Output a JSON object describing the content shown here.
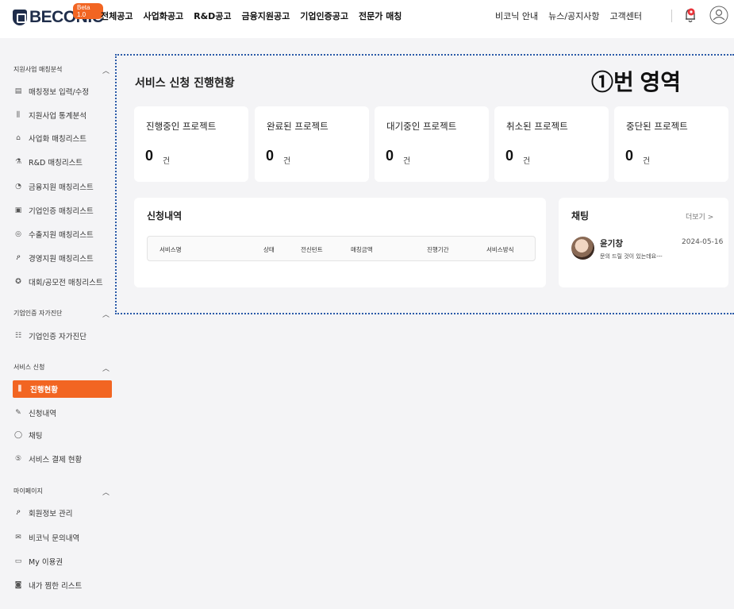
{
  "brand": {
    "logo_text": "BECONIC",
    "beta_badge": "Beta 1.0",
    "accent": "#f26522",
    "navy": "#1f2d4a"
  },
  "gnb": [
    "전체공고",
    "사업화공고",
    "R&D공고",
    "금융지원공고",
    "기업인증공고",
    "전문가 매칭"
  ],
  "util_nav": [
    "비코닉 안내",
    "뉴스/공지사항",
    "고객센터"
  ],
  "sidebar": {
    "sections": [
      {
        "title": "지원사업 매칭분석",
        "items": [
          {
            "icon": "document-icon",
            "label": "매칭정보 입력/수정"
          },
          {
            "icon": "chart-icon",
            "label": "지원사업 통계분석"
          },
          {
            "icon": "building-icon",
            "label": "사업화 매칭리스트"
          },
          {
            "icon": "flask-icon",
            "label": "R&D 매칭리스트"
          },
          {
            "icon": "coin-icon",
            "label": "금융지원 매칭리스트"
          },
          {
            "icon": "certificate-icon",
            "label": "기업인증 매칭리스트"
          },
          {
            "icon": "globe-icon",
            "label": "수출지원 매칭리스트"
          },
          {
            "icon": "people-icon",
            "label": "경영지원 매칭리스트"
          },
          {
            "icon": "medal-icon",
            "label": "대회/공모전 매칭리스트"
          }
        ]
      },
      {
        "title": "기업인증 자가진단",
        "items": [
          {
            "icon": "checklist-icon",
            "label": "기업인증 자가진단"
          }
        ]
      },
      {
        "title": "서비스 신청",
        "items": [
          {
            "icon": "chart-icon",
            "label": "진행현황",
            "active": true
          },
          {
            "icon": "edit-icon",
            "label": "신청내역"
          },
          {
            "icon": "chat-icon",
            "label": "채팅"
          },
          {
            "icon": "payment-icon",
            "label": "서비스 결제 현황"
          }
        ]
      },
      {
        "title": "마이페이지",
        "items": [
          {
            "icon": "user-edit-icon",
            "label": "회원정보 관리"
          },
          {
            "icon": "mail-icon",
            "label": "비코닉 문의내역"
          },
          {
            "icon": "ticket-icon",
            "label": "My 이용권"
          },
          {
            "icon": "bookmark-icon",
            "label": "내가 찜한 리스트"
          }
        ]
      }
    ]
  },
  "main": {
    "title": "서비스 신청 진행현황",
    "region_label": "①번 영역",
    "stats": [
      {
        "label": "진행중인 프로젝트",
        "value": "0",
        "unit": "건"
      },
      {
        "label": "완료된 프로젝트",
        "value": "0",
        "unit": "건"
      },
      {
        "label": "대기중인 프로젝트",
        "value": "0",
        "unit": "건"
      },
      {
        "label": "취소된 프로젝트",
        "value": "0",
        "unit": "건"
      },
      {
        "label": "중단된 프로젝트",
        "value": "0",
        "unit": "건"
      }
    ],
    "apply": {
      "title": "신청내역",
      "columns": [
        "서비스명",
        "상태",
        "전신턴트",
        "매칭금액",
        "진행기간",
        "서비스방식"
      ]
    },
    "chat": {
      "title": "채팅",
      "more": "더보기 >",
      "name": "윤기창",
      "date": "2024-05-16",
      "message": "문의 드릴 것이 있는데요---"
    }
  }
}
